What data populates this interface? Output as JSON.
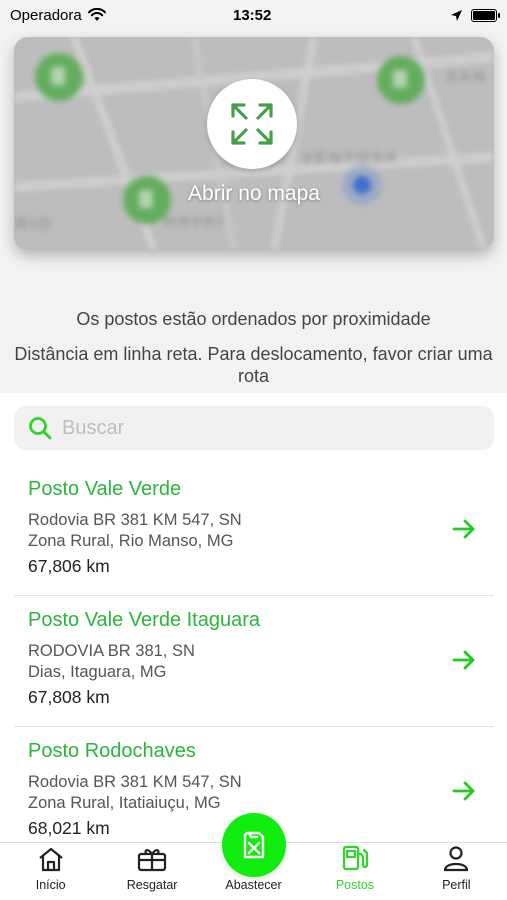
{
  "status_bar": {
    "carrier": "Operadora",
    "time": "13:52",
    "battery_level": 1.0
  },
  "map": {
    "open_label": "Abrir no mapa",
    "street_labels": [
      "VENTOSA",
      "HAVAÍ",
      "RIO",
      "SAN"
    ]
  },
  "info": {
    "line1": "Os postos estão ordenados por proximidade",
    "line2": "Distância em linha reta. Para deslocamento, favor criar uma rota"
  },
  "search": {
    "placeholder": "Buscar",
    "value": ""
  },
  "stations": [
    {
      "name": "Posto Vale Verde",
      "address1": "Rodovia BR 381 KM 547, SN",
      "address2": "Zona Rural, Rio Manso, MG",
      "distance": "67,806 km"
    },
    {
      "name": "Posto Vale Verde Itaguara",
      "address1": "RODOVIA BR 381, SN",
      "address2": "Dias, Itaguara, MG",
      "distance": "67,808 km"
    },
    {
      "name": "Posto Rodochaves",
      "address1": "Rodovia BR 381 KM 547, SN",
      "address2": "Zona Rural, Itatiaiuçu, MG",
      "distance": "68,021 km"
    }
  ],
  "tabs": [
    {
      "label": "Início",
      "icon": "home-icon"
    },
    {
      "label": "Resgatar",
      "icon": "gift-icon"
    },
    {
      "label": "Abastecer",
      "icon": "fuel-icon"
    },
    {
      "label": "Postos",
      "icon": "gas-station-icon"
    },
    {
      "label": "Perfil",
      "icon": "person-icon"
    }
  ],
  "active_tab": "Postos",
  "colors": {
    "accent": "#2bb53b",
    "active_tab": "#33d22f",
    "fab": "#11ec0f",
    "arrow": "#1ecb1e"
  }
}
